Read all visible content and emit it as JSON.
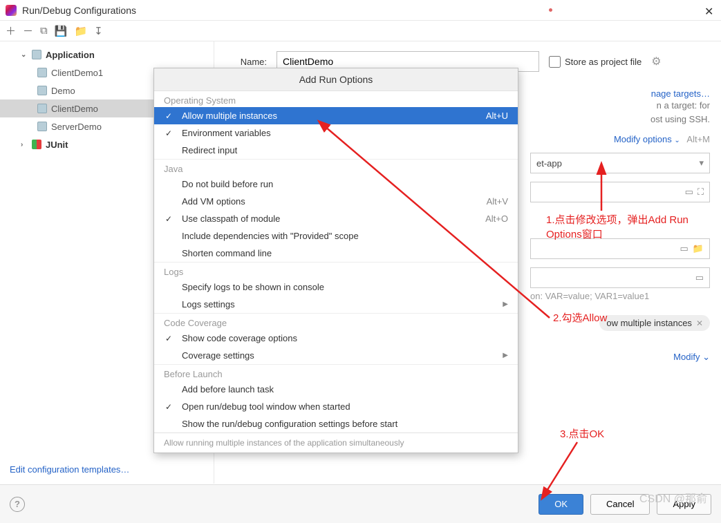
{
  "window": {
    "title": "Run/Debug Configurations"
  },
  "toolbarIcons": [
    "＋",
    "－",
    "⧉",
    "💾",
    "📁",
    "↧"
  ],
  "tree": {
    "application": "Application",
    "items": [
      "ClientDemo1",
      "Demo",
      "ClientDemo",
      "ServerDemo"
    ],
    "selectedIndex": 2,
    "junit": "JUnit"
  },
  "form": {
    "nameLabel": "Name:",
    "nameValue": "ClientDemo",
    "store": "Store as project file",
    "manageTargets": "nage targets…",
    "targetHint1": "n a target: for",
    "targetHint2": "ost using SSH.",
    "modifyOptions": "Modify options",
    "modifyKb": "Alt+M",
    "appSelect": "et-app",
    "envHint": "on: VAR=value; VAR1=value1",
    "chip": "ow multiple instances",
    "modify": "Modify"
  },
  "popup": {
    "title": "Add Run Options",
    "sections": [
      {
        "name": "Operating System",
        "items": [
          {
            "label": "Allow multiple instances",
            "checked": true,
            "kb": "Alt+U",
            "selected": true
          },
          {
            "label": "Environment variables",
            "checked": true
          },
          {
            "label": "Redirect input"
          }
        ]
      },
      {
        "name": "Java",
        "items": [
          {
            "label": "Do not build before run"
          },
          {
            "label": "Add VM options",
            "kb": "Alt+V"
          },
          {
            "label": "Use classpath of module",
            "checked": true,
            "kb": "Alt+O"
          },
          {
            "label": "Include dependencies with \"Provided\" scope"
          },
          {
            "label": "Shorten command line"
          }
        ]
      },
      {
        "name": "Logs",
        "items": [
          {
            "label": "Specify logs to be shown in console"
          },
          {
            "label": "Logs settings",
            "submenu": true
          }
        ]
      },
      {
        "name": "Code Coverage",
        "items": [
          {
            "label": "Show code coverage options",
            "checked": true
          },
          {
            "label": "Coverage settings",
            "submenu": true
          }
        ]
      },
      {
        "name": "Before Launch",
        "items": [
          {
            "label": "Add before launch task"
          },
          {
            "label": "Open run/debug tool window when started",
            "checked": true
          },
          {
            "label": "Show the run/debug configuration settings before start"
          }
        ]
      }
    ],
    "footer": "Allow running multiple instances of the application simultaneously"
  },
  "annotations": {
    "a1": "1.点击修改选项，弹出Add Run Options窗口",
    "a2": "2.勾选Allow",
    "a3": "3.点击OK"
  },
  "buttons": {
    "ok": "OK",
    "cancel": "Cancel",
    "apply": "Apply"
  },
  "editTemplates": "Edit configuration templates…",
  "watermark": "CSDN @那俞"
}
